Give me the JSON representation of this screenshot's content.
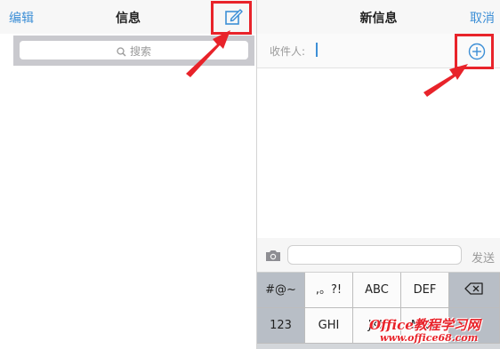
{
  "left": {
    "nav": {
      "edit_label": "编辑",
      "title": "信息"
    },
    "search": {
      "placeholder": "搜索"
    },
    "compose_icon": "compose-icon"
  },
  "right": {
    "nav": {
      "title": "新信息",
      "cancel_label": "取消"
    },
    "recipient": {
      "label": "收件人:",
      "value": ""
    },
    "add_icon": "add-contact-icon",
    "input": {
      "send_label": "发送",
      "value": "",
      "camera_icon": "camera-icon"
    },
    "keyboard": {
      "rows": [
        [
          "#@~",
          ",。?!",
          "ABC",
          "DEF",
          "⌫"
        ],
        [
          "123",
          "GHI",
          "JKL",
          "MNO",
          ""
        ]
      ]
    }
  },
  "annotations": {
    "highlight_color": "#e8232a"
  },
  "watermark": {
    "logo": "Office教程学习网",
    "url": "www.office68.com"
  },
  "colors": {
    "accent": "#3d8fd6",
    "annotation": "#e8232a"
  }
}
